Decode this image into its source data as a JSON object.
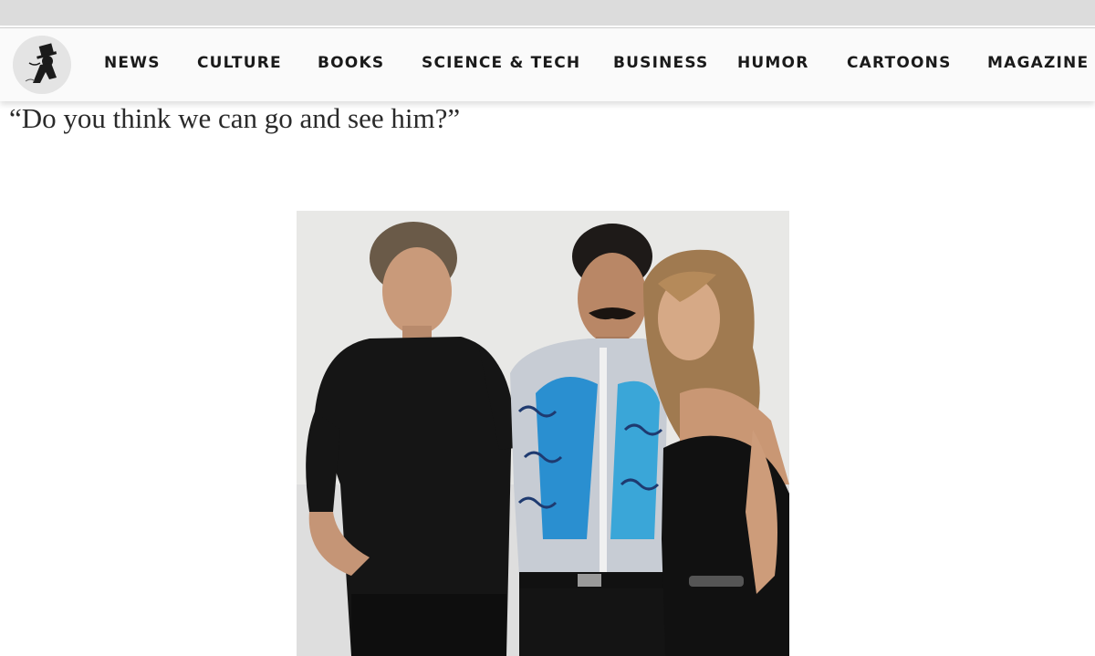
{
  "nav": {
    "logo_icon": "top-hat-dandy-logo-icon",
    "items": [
      {
        "label": "NEWS"
      },
      {
        "label": "CULTURE"
      },
      {
        "label": "BOOKS"
      },
      {
        "label": "SCIENCE & TECH"
      },
      {
        "label": "BUSINESS"
      },
      {
        "label": "HUMOR"
      },
      {
        "label": "CARTOONS"
      },
      {
        "label": "MAGAZINE"
      }
    ]
  },
  "article": {
    "quote": "“Do you think we can go and see him?”"
  },
  "colors": {
    "nav_background": "#fafafa",
    "top_strip": "#dcdcdc",
    "text": "#1a1a1a"
  }
}
